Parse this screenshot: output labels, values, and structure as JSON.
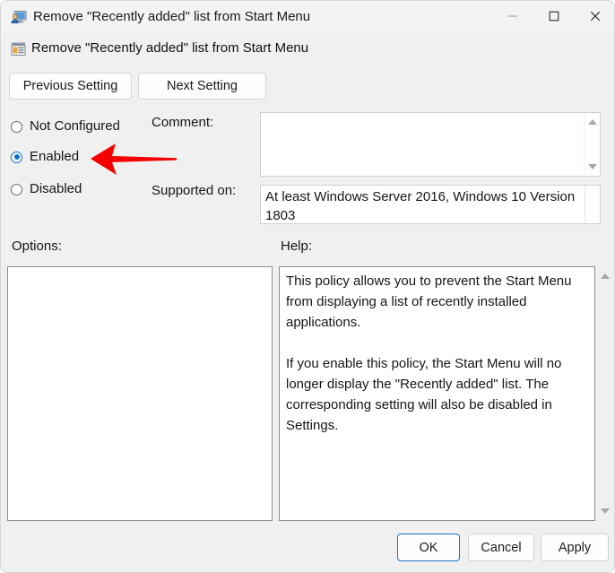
{
  "window": {
    "title": "Remove \"Recently added\" list from Start Menu",
    "icon": "group-policy-editor-icon",
    "controls": {
      "minimize": "minimize-icon",
      "maximize": "maximize-icon",
      "close": "close-icon"
    }
  },
  "policy_header": {
    "icon": "policy-setting-icon",
    "title": "Remove \"Recently added\" list from Start Menu"
  },
  "navigation": {
    "previous_label": "Previous Setting",
    "next_label": "Next Setting"
  },
  "state_options": {
    "items": [
      {
        "label": "Not Configured",
        "selected": false
      },
      {
        "label": "Enabled",
        "selected": true
      },
      {
        "label": "Disabled",
        "selected": false
      }
    ],
    "selected_value": "Enabled"
  },
  "comment": {
    "label": "Comment:",
    "value": "",
    "scroll_up_icon": "scroll-up-arrow-icon",
    "scroll_down_icon": "scroll-down-arrow-icon"
  },
  "supported_on": {
    "label": "Supported on:",
    "value": "At least Windows Server 2016, Windows 10 Version 1803"
  },
  "options": {
    "label": "Options:",
    "content": ""
  },
  "help": {
    "label": "Help:",
    "content": "This policy allows you to prevent the Start Menu from displaying a list of recently installed applications.\n\nIf you enable this policy, the Start Menu will no longer display the \"Recently added\" list. The corresponding setting will also be disabled in Settings.",
    "scroll_up_icon": "scroll-up-arrow-icon",
    "scroll_down_icon": "scroll-down-arrow-icon"
  },
  "footer": {
    "ok_label": "OK",
    "cancel_label": "Cancel",
    "apply_label": "Apply"
  },
  "annotation": {
    "type": "red-arrow",
    "points_to": "Enabled",
    "color": "#f40000"
  }
}
